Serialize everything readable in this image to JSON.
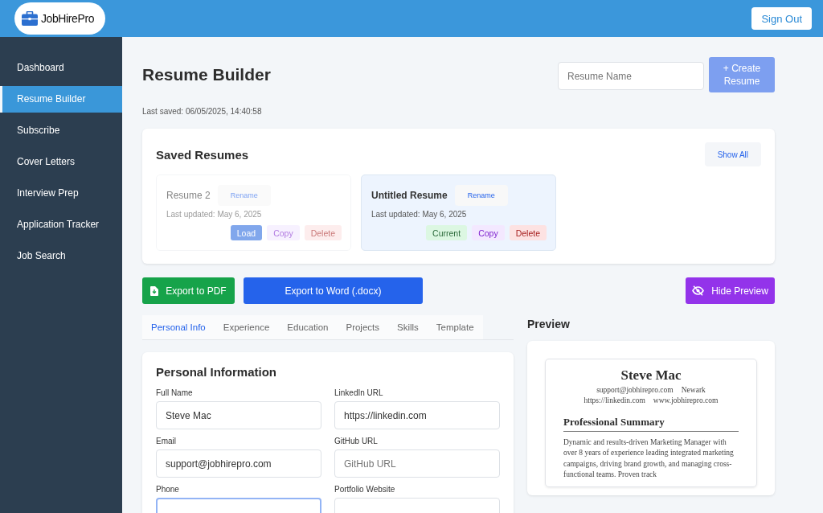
{
  "header": {
    "logo_text": "JobHirePro",
    "sign_out": "Sign Out"
  },
  "sidebar": {
    "items": [
      {
        "label": "Dashboard",
        "selected": false
      },
      {
        "label": "Resume Builder",
        "selected": true
      },
      {
        "label": "Subscribe",
        "selected": false
      },
      {
        "label": "Cover Letters",
        "selected": false
      },
      {
        "label": "Interview Prep",
        "selected": false
      },
      {
        "label": "Application Tracker",
        "selected": false
      },
      {
        "label": "Job Search",
        "selected": false
      }
    ]
  },
  "page": {
    "title": "Resume Builder",
    "last_saved": "Last saved: 06/05/2025, 14:40:58",
    "name_field": {
      "placeholder": "Resume Name"
    },
    "create_button": "+ Create Resume"
  },
  "saved_resumes": {
    "title": "Saved Resumes",
    "show_all": "Show All",
    "items": [
      {
        "name": "Resume 2",
        "rename": "Rename",
        "updated": "Last updated: May 6, 2025",
        "selected": false,
        "status": "Load",
        "copy": "Copy",
        "delete": "Delete"
      },
      {
        "name": "Untitled Resume",
        "rename": "Rename",
        "updated": "Last updated: May 6, 2025",
        "selected": true,
        "status": "Current",
        "copy": "Copy",
        "delete": "Delete"
      }
    ]
  },
  "actions": {
    "export_pdf": "Export to PDF",
    "export_word": "Export to Word (.docx)",
    "hide_preview": "Hide Preview"
  },
  "tabs": [
    {
      "label": "Personal Info",
      "selected": true
    },
    {
      "label": "Experience",
      "selected": false
    },
    {
      "label": "Education",
      "selected": false
    },
    {
      "label": "Projects",
      "selected": false
    },
    {
      "label": "Skills",
      "selected": false
    },
    {
      "label": "Template",
      "selected": false
    }
  ],
  "form": {
    "title": "Personal Information",
    "fields": [
      {
        "label": "Full Name",
        "value": "Steve Mac"
      },
      {
        "label": "LinkedIn URL",
        "value": "https://linkedin.com"
      },
      {
        "label": "Email",
        "value": "support@jobhirepro.com"
      },
      {
        "label": "GitHub URL",
        "placeholder": "GitHub URL"
      },
      {
        "label": "Phone",
        "focused": true
      },
      {
        "label": "Portfolio Website"
      }
    ]
  },
  "preview": {
    "title": "Preview",
    "name": "Steve Mac",
    "contact_line_1": [
      "support@jobhirepro.com",
      "Newark"
    ],
    "contact_line_2": [
      "https://linkedin.com",
      "www.jobhirepro.com"
    ],
    "section_title": "Professional Summary",
    "summary": "Dynamic and results-driven Marketing Manager with over 8 years of experience leading integrated marketing campaigns, driving brand growth, and managing cross-functional teams. Proven track"
  }
}
